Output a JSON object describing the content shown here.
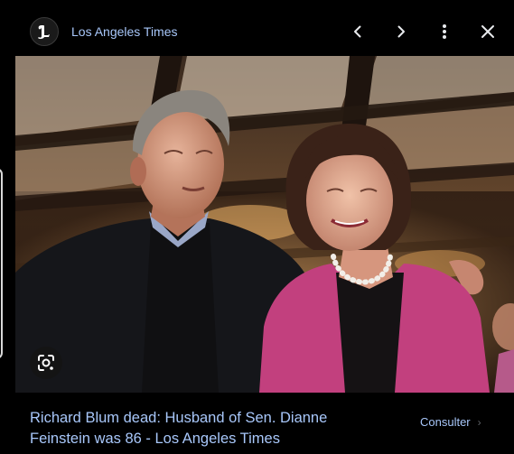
{
  "header": {
    "source_name": "Los Angeles Times",
    "logo_letter": "L",
    "prev_icon": "chevron-left-icon",
    "next_icon": "chevron-right-icon",
    "more_icon": "more-vertical-icon",
    "close_icon": "close-icon"
  },
  "image": {
    "lens_icon": "lens-search-icon"
  },
  "caption": {
    "title": "Richard Blum dead: Husband of Sen. Dianne Feinstein was 86 - Los Angeles Times",
    "visit_label": "Consulter",
    "visit_icon": "chevron-right-icon"
  },
  "colors": {
    "background": "#000000",
    "link": "#a8c7fa",
    "jacket": "#c2407e"
  }
}
